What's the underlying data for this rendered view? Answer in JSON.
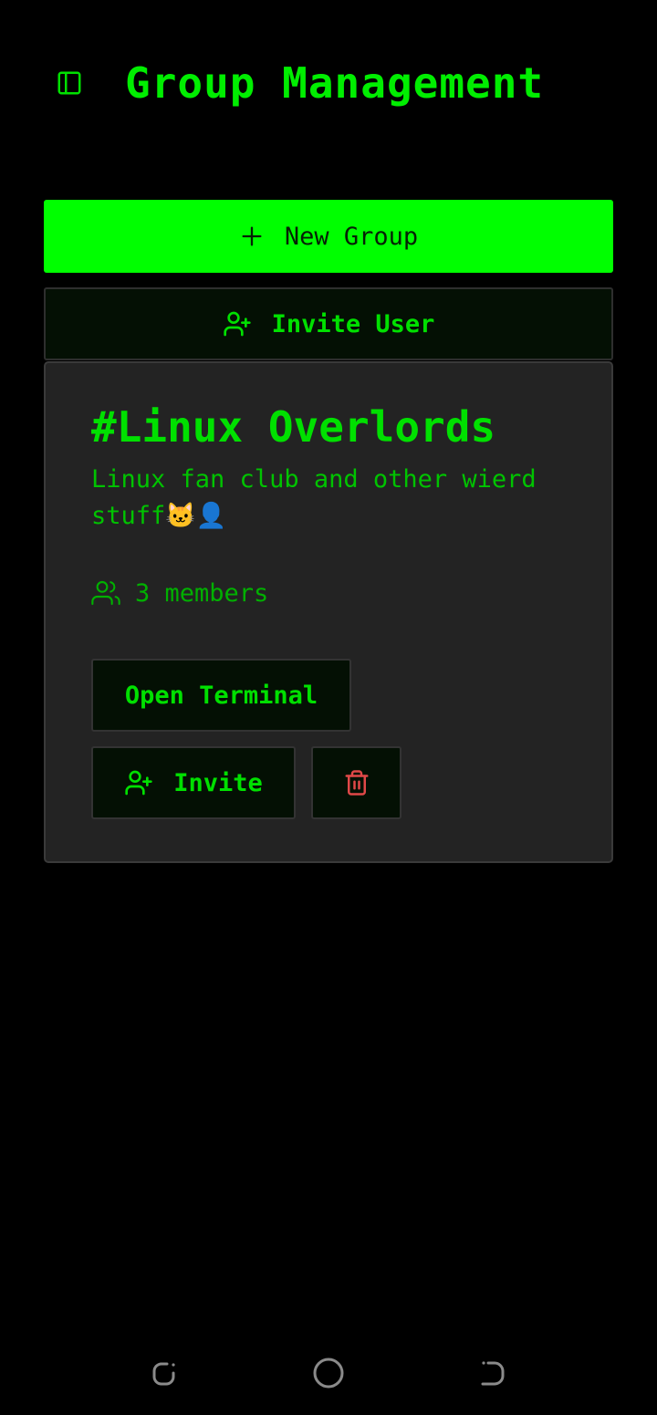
{
  "header": {
    "title": "Group Management",
    "toggle_icon": "sidebar-panel-icon"
  },
  "actions": {
    "new_group_label": "New Group",
    "new_group_icon": "plus-icon",
    "invite_user_label": "Invite User",
    "invite_user_icon": "user-plus-icon"
  },
  "group": {
    "name": "#Linux Overlords",
    "description": "Linux fan club and other wierd stuff🐱👤",
    "members_text": "3 members",
    "members_icon": "users-icon",
    "open_terminal_label": "Open Terminal",
    "invite_label": "Invite",
    "delete_icon": "trash-icon"
  },
  "system_nav": {
    "recents_icon": "recents-icon",
    "home_icon": "home-circle-icon",
    "back_icon": "back-icon"
  },
  "colors": {
    "background": "#000000",
    "accent": "#00ff00",
    "text_green": "#00e000",
    "card_background": "#232323",
    "danger": "#e04848"
  }
}
